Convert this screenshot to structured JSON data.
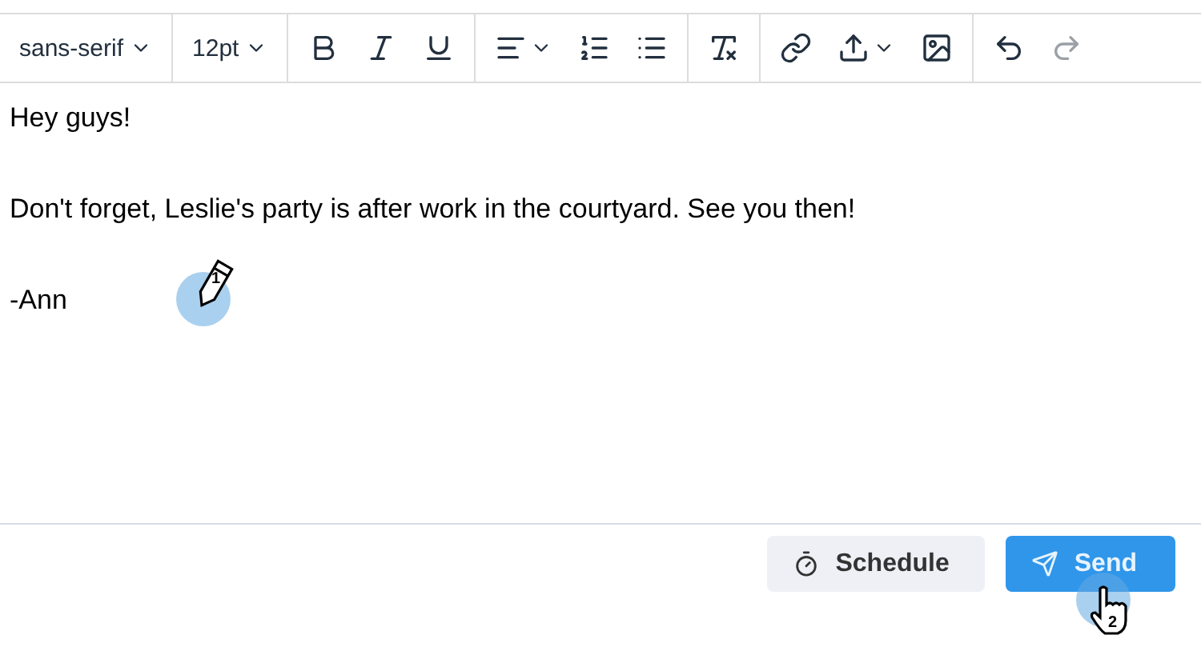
{
  "toolbar": {
    "groups": [
      {
        "items": [
          {
            "kind": "dropdown",
            "label": "sans-serif"
          }
        ]
      },
      {
        "items": [
          {
            "kind": "dropdown",
            "label": "12pt"
          }
        ]
      },
      {
        "items": [
          {
            "kind": "button",
            "disabled": false
          },
          {
            "kind": "button",
            "disabled": false
          },
          {
            "kind": "button",
            "disabled": false
          }
        ]
      },
      {
        "items": [
          {
            "kind": "split",
            "disabled": false
          },
          {
            "kind": "button",
            "disabled": false
          },
          {
            "kind": "button",
            "disabled": false
          }
        ]
      },
      {
        "items": [
          {
            "kind": "button",
            "disabled": false
          }
        ]
      },
      {
        "items": [
          {
            "kind": "button",
            "disabled": false
          },
          {
            "kind": "split",
            "disabled": false
          },
          {
            "kind": "button",
            "disabled": false
          }
        ]
      },
      {
        "items": [
          {
            "kind": "button",
            "disabled": false
          },
          {
            "kind": "button",
            "disabled": true
          }
        ]
      }
    ]
  },
  "body": {
    "paragraphs": [
      "Hey guys!",
      "Don't forget, Leslie's party is after work in the courtyard. See you then!",
      "-Ann"
    ]
  },
  "footer": {
    "buttons": [
      {
        "label": "Schedule",
        "kind": "secondary"
      },
      {
        "label": "Send",
        "kind": "primary"
      }
    ]
  },
  "markers": [
    {
      "kind": "pencil",
      "label": "1"
    },
    {
      "kind": "hand",
      "label": "2"
    }
  ]
}
